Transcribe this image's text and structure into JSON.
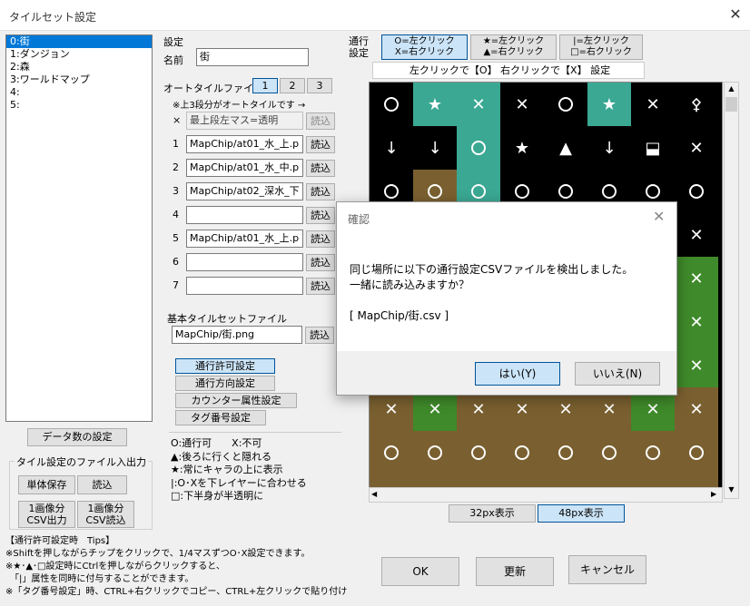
{
  "window": {
    "title": "タイルセット設定",
    "close_glyph": "✕"
  },
  "tileset_list": [
    "0:街",
    "1:ダンジョン",
    "2:森",
    "3:ワールドマップ",
    "4:",
    "5:"
  ],
  "left_buttons": {
    "data_count": "データ数の設定",
    "io_group_label": "タイル設定のファイル入出力",
    "single_save": "単体保存",
    "load": "読込",
    "csv_out": "1画像分\nCSV出力",
    "csv_in": "1画像分\nCSV読込"
  },
  "settings": {
    "section_label": "設定",
    "name_label": "名前",
    "name_value": "街",
    "autotile_label": "オートタイルファイル",
    "autotile_pages": [
      "1",
      "2",
      "3"
    ],
    "autotile_note": "※上3段分がオートタイルです →",
    "load_label": "読込",
    "autotile_rows": [
      {
        "index": "×",
        "value": "最上段左マス=透明",
        "disabled": true
      },
      {
        "index": "1",
        "value": "MapChip/at01_水_上.p"
      },
      {
        "index": "2",
        "value": "MapChip/at01_水_中.p"
      },
      {
        "index": "3",
        "value": "MapChip/at02_深水_下"
      },
      {
        "index": "4",
        "value": ""
      },
      {
        "index": "5",
        "value": "MapChip/at01_水_上.p"
      },
      {
        "index": "6",
        "value": ""
      },
      {
        "index": "7",
        "value": ""
      }
    ],
    "base_file_label": "基本タイルセットファイル",
    "base_file_value": "MapChip/街.png"
  },
  "mode_buttons": [
    "通行許可設定",
    "通行方向設定",
    "カウンター属性設定",
    "タグ番号設定"
  ],
  "legend": [
    "O:通行可　　X:不可",
    "▲:後ろに行くと隠れる",
    "★:常にキャラの上に表示",
    "|:O･Xを下レイヤーに合わせる",
    "□:下半身が半透明に"
  ],
  "pass_header": {
    "label": "通行\n設定",
    "b1": "O=左クリック\nX=右クリック",
    "b2": "★=左クリック\n▲=右クリック",
    "b3": "|=左クリック\n□=右クリック",
    "hint": "左クリックで【O】 右クリックで【X】 設定"
  },
  "zoom_buttons": [
    "32px表示",
    "48px表示"
  ],
  "tips": [
    "【通行許可設定時　Tips】",
    "※Shiftを押しながらチップをクリックで、1/4マスずつO･X設定できます。",
    "※★･▲･□設定時にCtrlを押しながらクリックすると、",
    "　「|」属性を同時に付与することができます。",
    "※「タグ番号設定」時、CTRL+右クリックでコピー、CTRL+左クリックで貼り付け"
  ],
  "bottom_buttons": {
    "ok": "OK",
    "update": "更新",
    "cancel": "キャンセル"
  },
  "dialog": {
    "title": "確認",
    "message": "同じ場所に以下の通行設定CSVファイルを検出しました。\n一緒に読み込みますか？\n\n[ MapChip/街.csv ]",
    "yes": "はい(Y)",
    "no": "いいえ(N)"
  },
  "colors": {
    "accent": "#0078d7",
    "grid_bg": "#000000",
    "water": "#3aa893",
    "grass": "#3f8a2a",
    "dirt": "#7a6030"
  },
  "grid_cells": [
    [
      "o",
      "star",
      "x",
      "x",
      "o",
      "star",
      "x",
      "tree"
    ],
    [
      "down",
      "down",
      "o",
      "star",
      "tri",
      "down",
      "box",
      "x"
    ],
    [
      "o",
      "o",
      "o",
      "o",
      "o",
      "o",
      "o",
      "o"
    ],
    [
      "",
      "",
      "",
      "",
      "",
      "",
      "",
      "x"
    ],
    [
      "",
      "",
      "",
      "",
      "",
      "",
      "",
      "x"
    ],
    [
      "",
      "",
      "",
      "",
      "",
      "",
      "",
      "x"
    ],
    [
      "",
      "",
      "",
      "",
      "",
      "",
      "",
      "x"
    ],
    [
      "x",
      "x",
      "x",
      "x",
      "x",
      "x",
      "x",
      "x"
    ],
    [
      "o",
      "o",
      "o",
      "o",
      "o",
      "o",
      "o",
      "o"
    ],
    [
      "o",
      "o",
      "o",
      "o",
      "o",
      "o",
      "o",
      "o"
    ]
  ],
  "grid_terrain": [
    [
      "k",
      "w",
      "w",
      "k",
      "k",
      "w",
      "k",
      "k"
    ],
    [
      "k",
      "k",
      "w",
      "k",
      "k",
      "k",
      "k",
      "k"
    ],
    [
      "k",
      "d",
      "w",
      "k",
      "k",
      "k",
      "k",
      "k"
    ],
    [
      "k",
      "k",
      "k",
      "k",
      "k",
      "k",
      "k",
      "k"
    ],
    [
      "k",
      "k",
      "k",
      "k",
      "k",
      "k",
      "k",
      "g"
    ],
    [
      "k",
      "k",
      "k",
      "k",
      "k",
      "k",
      "k",
      "g"
    ],
    [
      "k",
      "k",
      "k",
      "k",
      "k",
      "k",
      "k",
      "g"
    ],
    [
      "d",
      "g",
      "d",
      "d",
      "d",
      "d",
      "g",
      "d"
    ],
    [
      "d",
      "d",
      "d",
      "d",
      "d",
      "d",
      "d",
      "d"
    ],
    [
      "d",
      "d",
      "d",
      "d",
      "d",
      "d",
      "d",
      "d"
    ]
  ]
}
